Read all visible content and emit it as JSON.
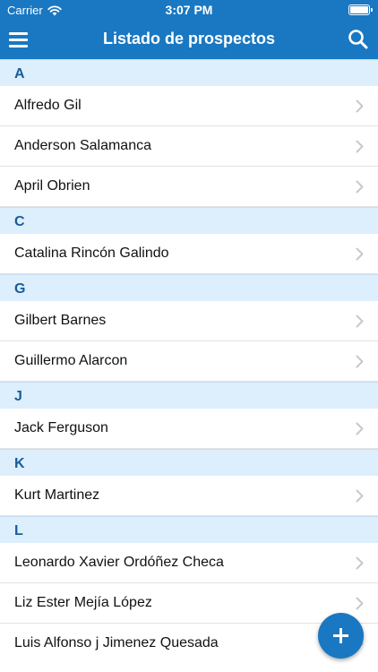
{
  "status_bar": {
    "carrier": "Carrier",
    "time": "3:07 PM",
    "icons": [
      "wifi-icon",
      "battery-icon"
    ]
  },
  "nav": {
    "title": "Listado de prospectos",
    "left_icon": "menu-icon",
    "right_icon": "search-icon"
  },
  "sections": [
    {
      "letter": "A",
      "items": [
        "Alfredo Gil",
        "Anderson Salamanca",
        "April Obrien"
      ]
    },
    {
      "letter": "C",
      "items": [
        "Catalina Rincón Galindo"
      ]
    },
    {
      "letter": "G",
      "items": [
        "Gilbert Barnes",
        "Guillermo Alarcon"
      ]
    },
    {
      "letter": "J",
      "items": [
        "Jack Ferguson"
      ]
    },
    {
      "letter": "K",
      "items": [
        "Kurt Martinez"
      ]
    },
    {
      "letter": "L",
      "items": [
        "Leonardo Xavier Ordóñez Checa",
        "Liz Ester Mejía López",
        "Luis Alfonso j Jimenez Quesada"
      ]
    }
  ],
  "fab": {
    "icon": "plus-icon"
  },
  "colors": {
    "primary": "#1a78c2",
    "section_bg": "#ddeefc",
    "section_text": "#1a5c9a",
    "chevron": "#c7c7cc"
  }
}
